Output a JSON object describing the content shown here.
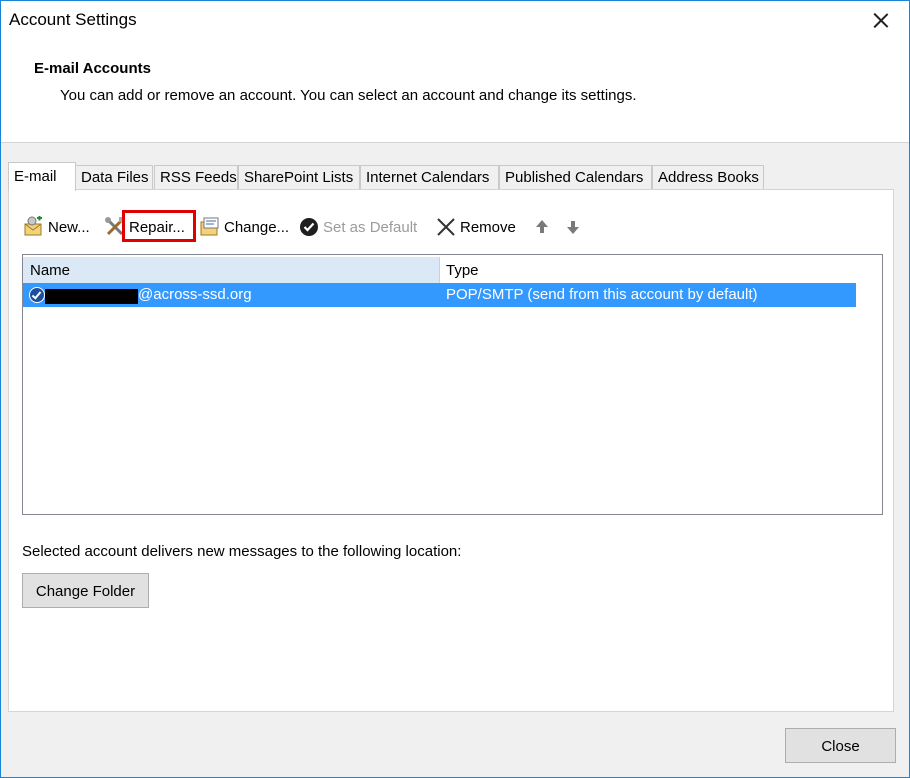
{
  "window": {
    "title": "Account Settings",
    "heading": "E-mail Accounts",
    "subheading": "You can add or remove an account. You can select an account and change its settings."
  },
  "tabs": [
    {
      "label": "E-mail",
      "active": true
    },
    {
      "label": "Data Files"
    },
    {
      "label": "RSS Feeds"
    },
    {
      "label": "SharePoint Lists"
    },
    {
      "label": "Internet Calendars"
    },
    {
      "label": "Published Calendars"
    },
    {
      "label": "Address Books"
    }
  ],
  "toolbar": {
    "new_label": "New...",
    "repair_label": "Repair...",
    "change_label": "Change...",
    "set_default_label": "Set as Default",
    "remove_label": "Remove"
  },
  "list": {
    "columns": {
      "name": "Name",
      "type": "Type"
    },
    "rows": [
      {
        "name": "@across-ssd.org",
        "type": "POP/SMTP (send from this account by default)"
      }
    ]
  },
  "deliver_text": "Selected account delivers new messages to the following location:",
  "buttons": {
    "change_folder": "Change Folder",
    "close": "Close"
  },
  "colors": {
    "selection": "#3399ff",
    "highlight_box": "#e00000",
    "header_bg": "#dbe9f7"
  }
}
